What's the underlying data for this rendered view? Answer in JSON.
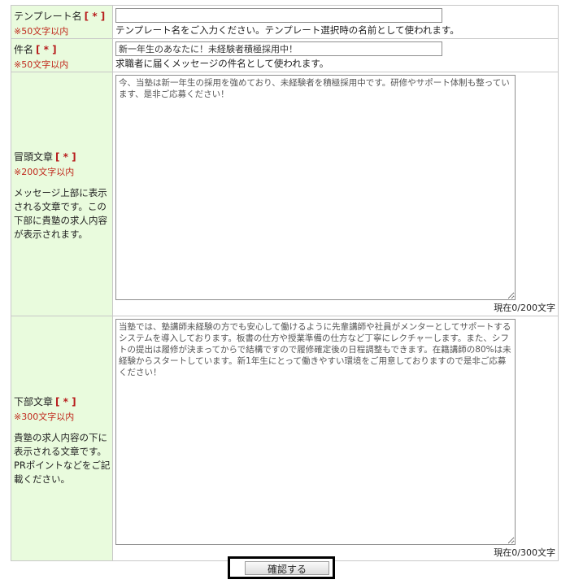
{
  "form": {
    "required_mark": "[ * ]",
    "template_name": {
      "label": "テンプレート名",
      "limit": "※50文字以内",
      "value": "",
      "hint": "テンプレート名をご入力ください。テンプレート選択時の名前として使われます。"
    },
    "subject": {
      "label": "件名",
      "limit": "※50文字以内",
      "value": "新一年生のあなたに！未経験者積極採用中！",
      "hint": "求職者に届くメッセージの件名として使われます。"
    },
    "intro": {
      "label": "冒頭文章",
      "limit": "※200文字以内",
      "desc": "メッセージ上部に表示される文章です。この下部に貴塾の求人内容が表示されます。",
      "value": "今、当塾は新一年生の採用を強めており、未経験者を積極採用中です。研修やサポート体制も整っています、是非ご応募ください！",
      "counter": "現在0/200文字"
    },
    "footer": {
      "label": "下部文章",
      "limit": "※300文字以内",
      "desc": "貴塾の求人内容の下に表示される文章です。PRポイントなどをご記載ください。",
      "value": "当塾では、塾講師未経験の方でも安心して働けるように先輩講師や社員がメンターとしてサポートするシステムを導入しております。板書の仕方や授業準備の仕方など丁寧にレクチャーします。また、シフトの提出は履修が決まってからで結構ですので履修確定後の日程調整もできます。在籍講師の80%は未経験からスタートしています。新1年生にとって働きやすい環境をご用意しておりますので是非ご応募ください！",
      "counter": "現在0/300文字"
    }
  },
  "submit": {
    "label": "確認する"
  }
}
